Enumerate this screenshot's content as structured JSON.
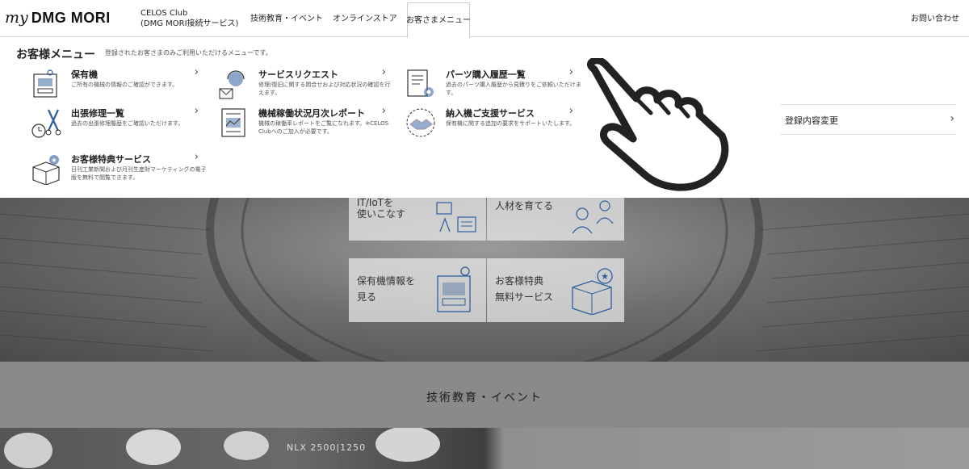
{
  "header": {
    "logo_my": "my",
    "logo_brand": "DMG MORI",
    "nav": {
      "celos_line1": "CELOS Club",
      "celos_line2": "(DMG MORI接続サービス)",
      "tech": "技術教育・イベント",
      "store": "オンラインストア",
      "menu": "お客さまメニュー",
      "contact": "お問い合わせ"
    }
  },
  "dropdown": {
    "title": "お客様メニュー",
    "subtitle": "登録されたお客さまのみご利用いただけるメニューです。",
    "items": [
      {
        "title": "保有機",
        "desc": "ご所有の機械の情報のご確認ができます。",
        "icon": "machine-book-icon"
      },
      {
        "title": "サービスリクエスト",
        "desc": "修理/復旧に関する問合せおよび対応状況の確認を行えます。",
        "icon": "headset-support-icon"
      },
      {
        "title": "パーツ購入履歴一覧",
        "desc": "過去のパーツ購入履歴から見積りをご依頼いただけます。",
        "icon": "parts-history-icon"
      },
      {
        "title": "出張修理一覧",
        "desc": "過去の出張修理履歴をご確認いただけます。",
        "icon": "repair-tools-icon"
      },
      {
        "title": "機械稼働状況月次レポート",
        "desc": "機械の稼働率レポートをご覧になれます。※CELOS Clubへのご加入が必要です。",
        "icon": "monthly-report-icon"
      },
      {
        "title": "納入機ご支援サービス",
        "desc": "保有機に関する追加の要求をサポートいたします。",
        "icon": "handshake-icon"
      },
      {
        "title": "お客様特典サービス",
        "desc": "日刊工業新聞および月刊生産財マーケティングの電子版を無料で閲覧できます。",
        "icon": "gift-box-icon"
      }
    ],
    "right_link": "登録内容変更"
  },
  "hero": {
    "tile_iot_line1": "IT/IoTを",
    "tile_iot_line2": "使いこなす",
    "tile_people": "人材を育てる",
    "tile_machine_line1": "保有機情報を",
    "tile_machine_line2": "見る",
    "tile_benefit_line1": "お客様特典",
    "tile_benefit_line2": "無料サービス"
  },
  "section": {
    "title": "技術教育・イベント"
  },
  "photo": {
    "machine_label": "NLX 2500|1250"
  },
  "colors": {
    "accent_blue": "#2e5e9e",
    "panel_bg": "#ffffff"
  }
}
